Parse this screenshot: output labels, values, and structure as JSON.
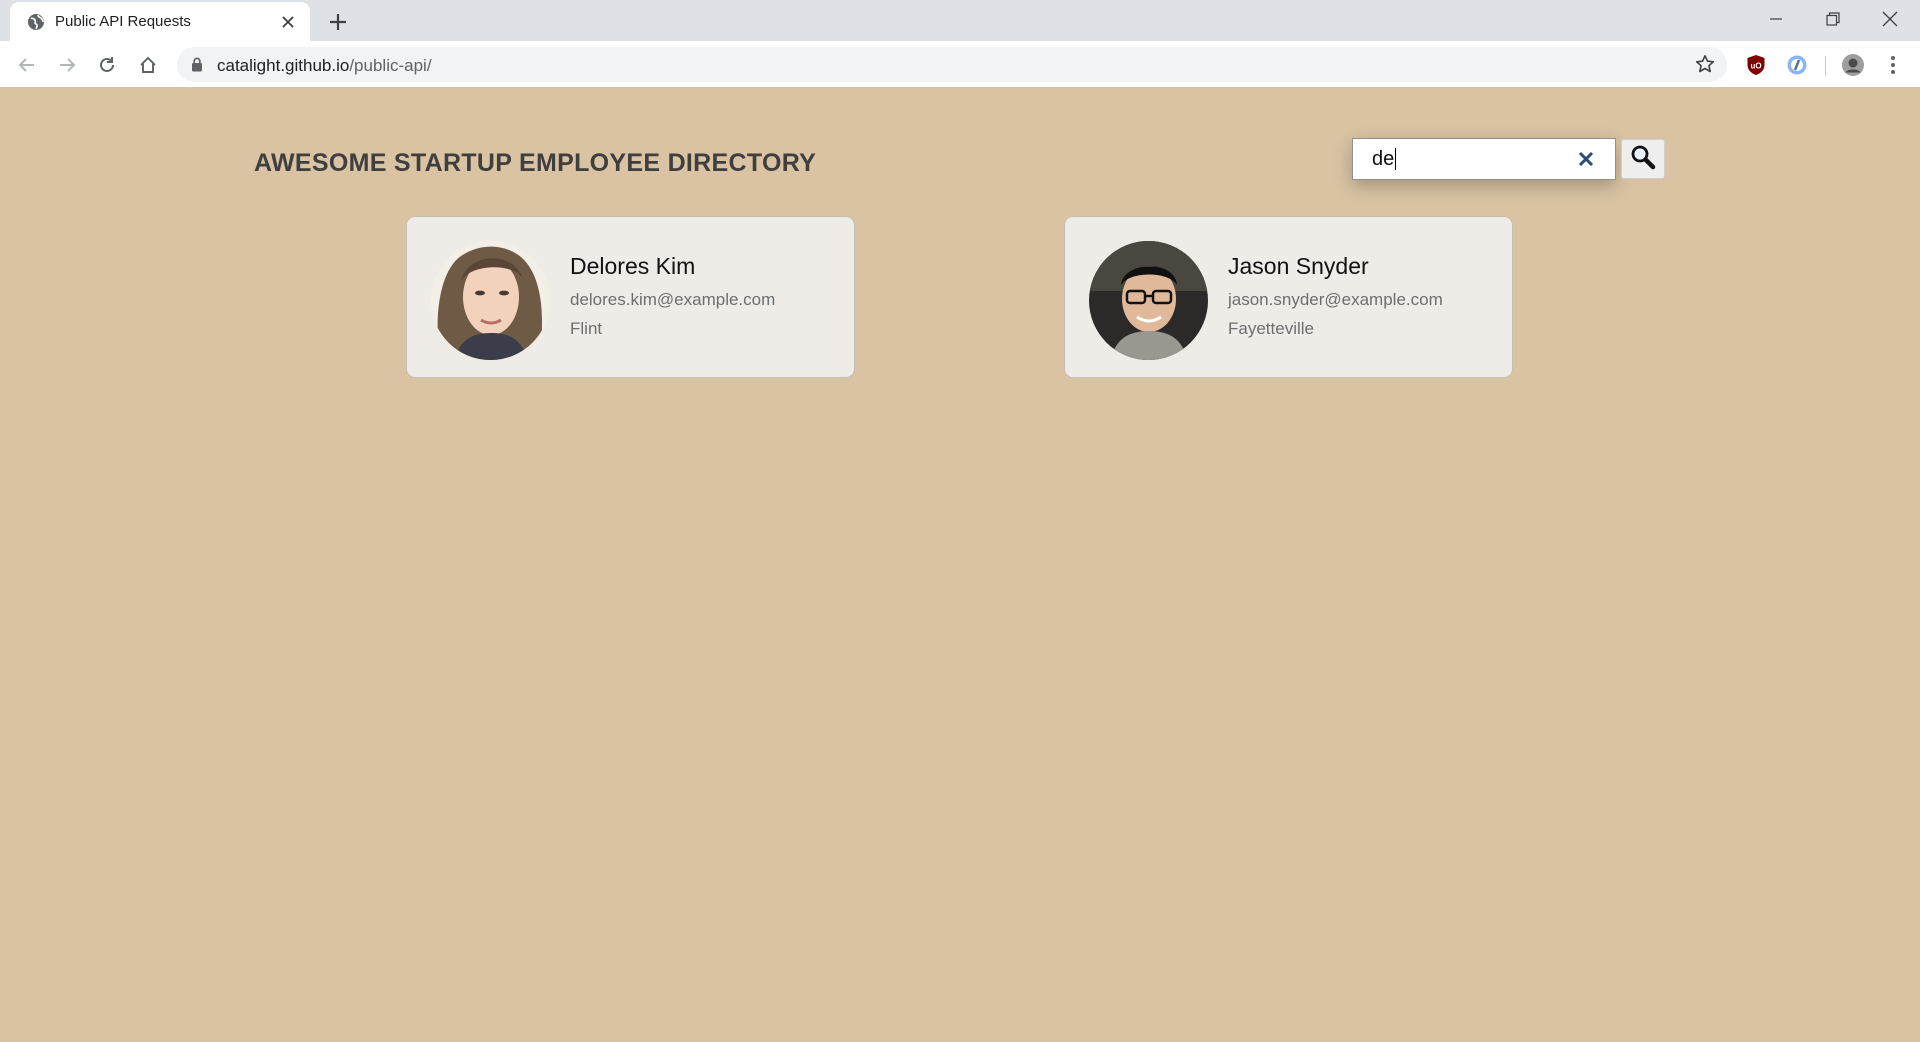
{
  "browser": {
    "tab_title": "Public API Requests",
    "url_domain": "catalight.github.io",
    "url_path": "/public-api/",
    "icons": [
      "globe-icon",
      "close-icon",
      "plus-icon",
      "back-icon",
      "forward-icon",
      "reload-icon",
      "home-icon",
      "lock-icon",
      "star-icon",
      "ublock-icon",
      "extension-icon",
      "profile-icon",
      "menu-icon",
      "minimize-icon",
      "restore-icon",
      "window-close-icon"
    ]
  },
  "page": {
    "title": "AWESOME STARTUP EMPLOYEE DIRECTORY",
    "search": {
      "value": "de",
      "icons": [
        "clear-icon",
        "search-icon"
      ]
    }
  },
  "employees": [
    {
      "name": "Delores Kim",
      "email": "delores.kim@example.com",
      "city": "Flint"
    },
    {
      "name": "Jason Snyder",
      "email": "jason.snyder@example.com",
      "city": "Fayetteville"
    }
  ],
  "colors": {
    "page_background": "#d9c3a3",
    "card_background": "#efece8",
    "clear_icon": "#2a4a78"
  }
}
